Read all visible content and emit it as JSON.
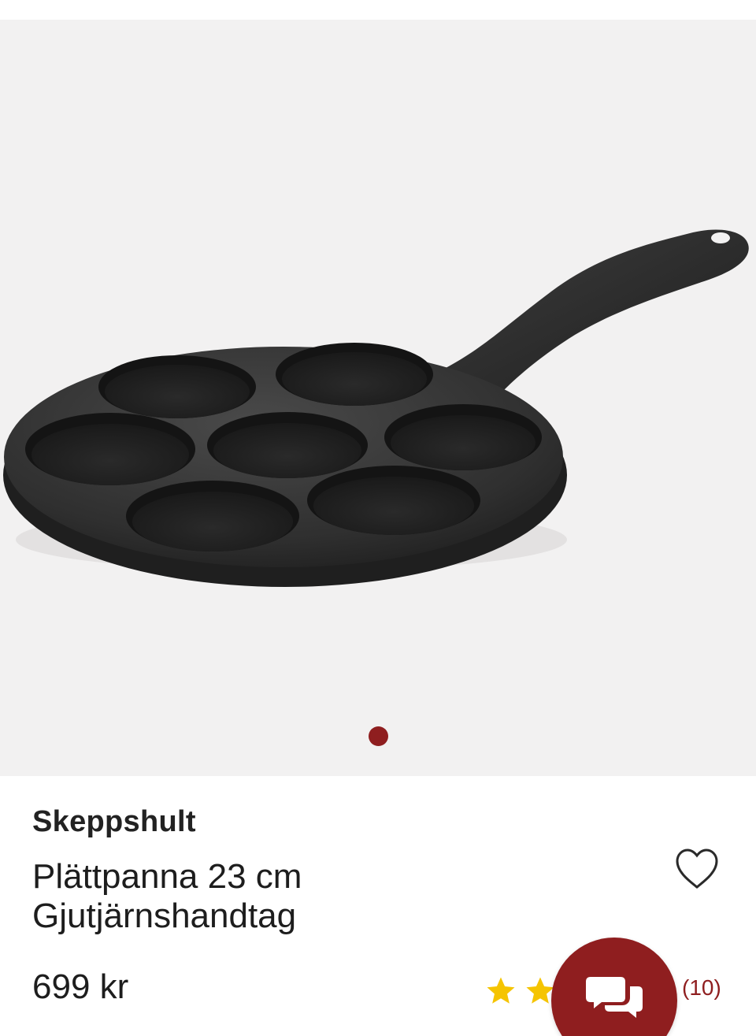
{
  "product": {
    "brand": "Skeppshult",
    "title_line1": "Plättpanna 23 cm",
    "title_line2": "Gjutjärnshandtag",
    "price": "699 kr",
    "review_count": "(10)",
    "image_icon": "cast-iron-pancake-pan-image"
  },
  "gallery": {
    "active_index": 1,
    "total": 1
  },
  "icons": {
    "wishlist": "heart-icon",
    "star": "star-icon",
    "chat": "chat-bubbles-icon"
  },
  "colors": {
    "accent": "#8f1e1f",
    "star": "#f5c400",
    "gallery_bg": "#f2f1f1",
    "text": "#1d1d1d"
  }
}
